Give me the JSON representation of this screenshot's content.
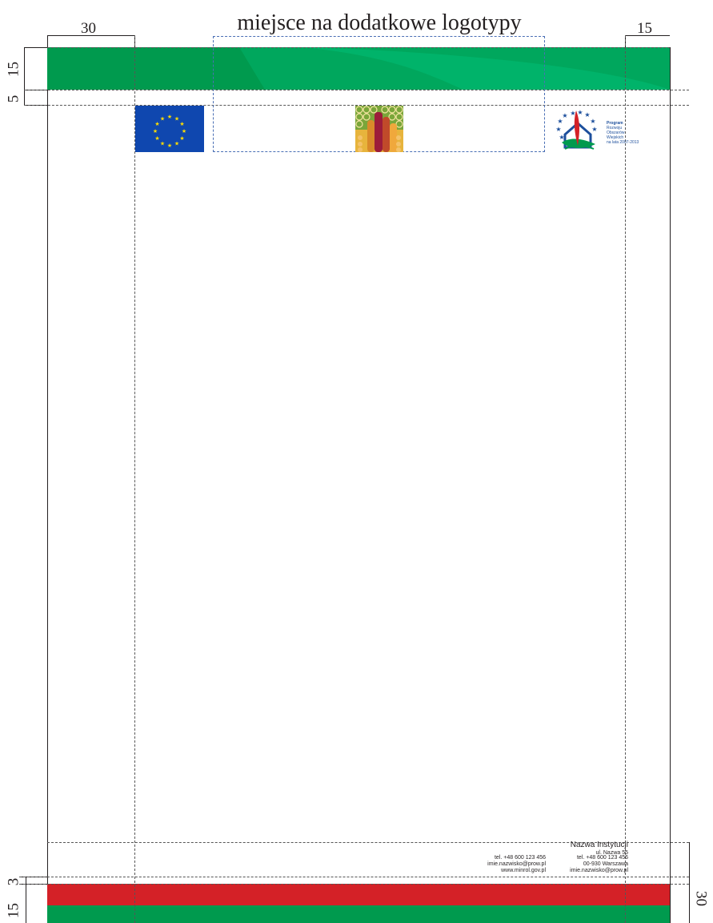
{
  "header": {
    "logos_area_label": "miejsce na dodatkowe logotypy"
  },
  "dimensions": {
    "left_margin": "30",
    "right_margin": "15",
    "top_band": "15",
    "top_gap": "5",
    "bottom_gap": "3",
    "bottom_band": "15",
    "footer_height": "30"
  },
  "logos": {
    "eu_flag_icon": "eu-flag-icon",
    "leader_logo_icon": "leader-logo-icon",
    "prow_logo_icon": "prow-logo-icon",
    "prow_text": [
      "Program",
      "Rozwoju",
      "Obszarów",
      "Wiejskich",
      "na lata 2007-2013"
    ]
  },
  "footer": {
    "institution_name": "Nazwa Instytucji",
    "address_street": "ul. Nazwa 55",
    "phone_1": "tel. +48 600 123 456",
    "phone_2": "tel. +48 600 123 456",
    "email_1": "imie.nazwisko@prow.pl",
    "postal": "00-930 Warszawa",
    "website": "www.minrol.gov.pl",
    "email_2": "imie.nazwisko@prow.pl"
  },
  "colors": {
    "green": "#009a4e",
    "red": "#d42127",
    "eu_blue": "#0f47af",
    "eu_yellow": "#ffdd00"
  }
}
